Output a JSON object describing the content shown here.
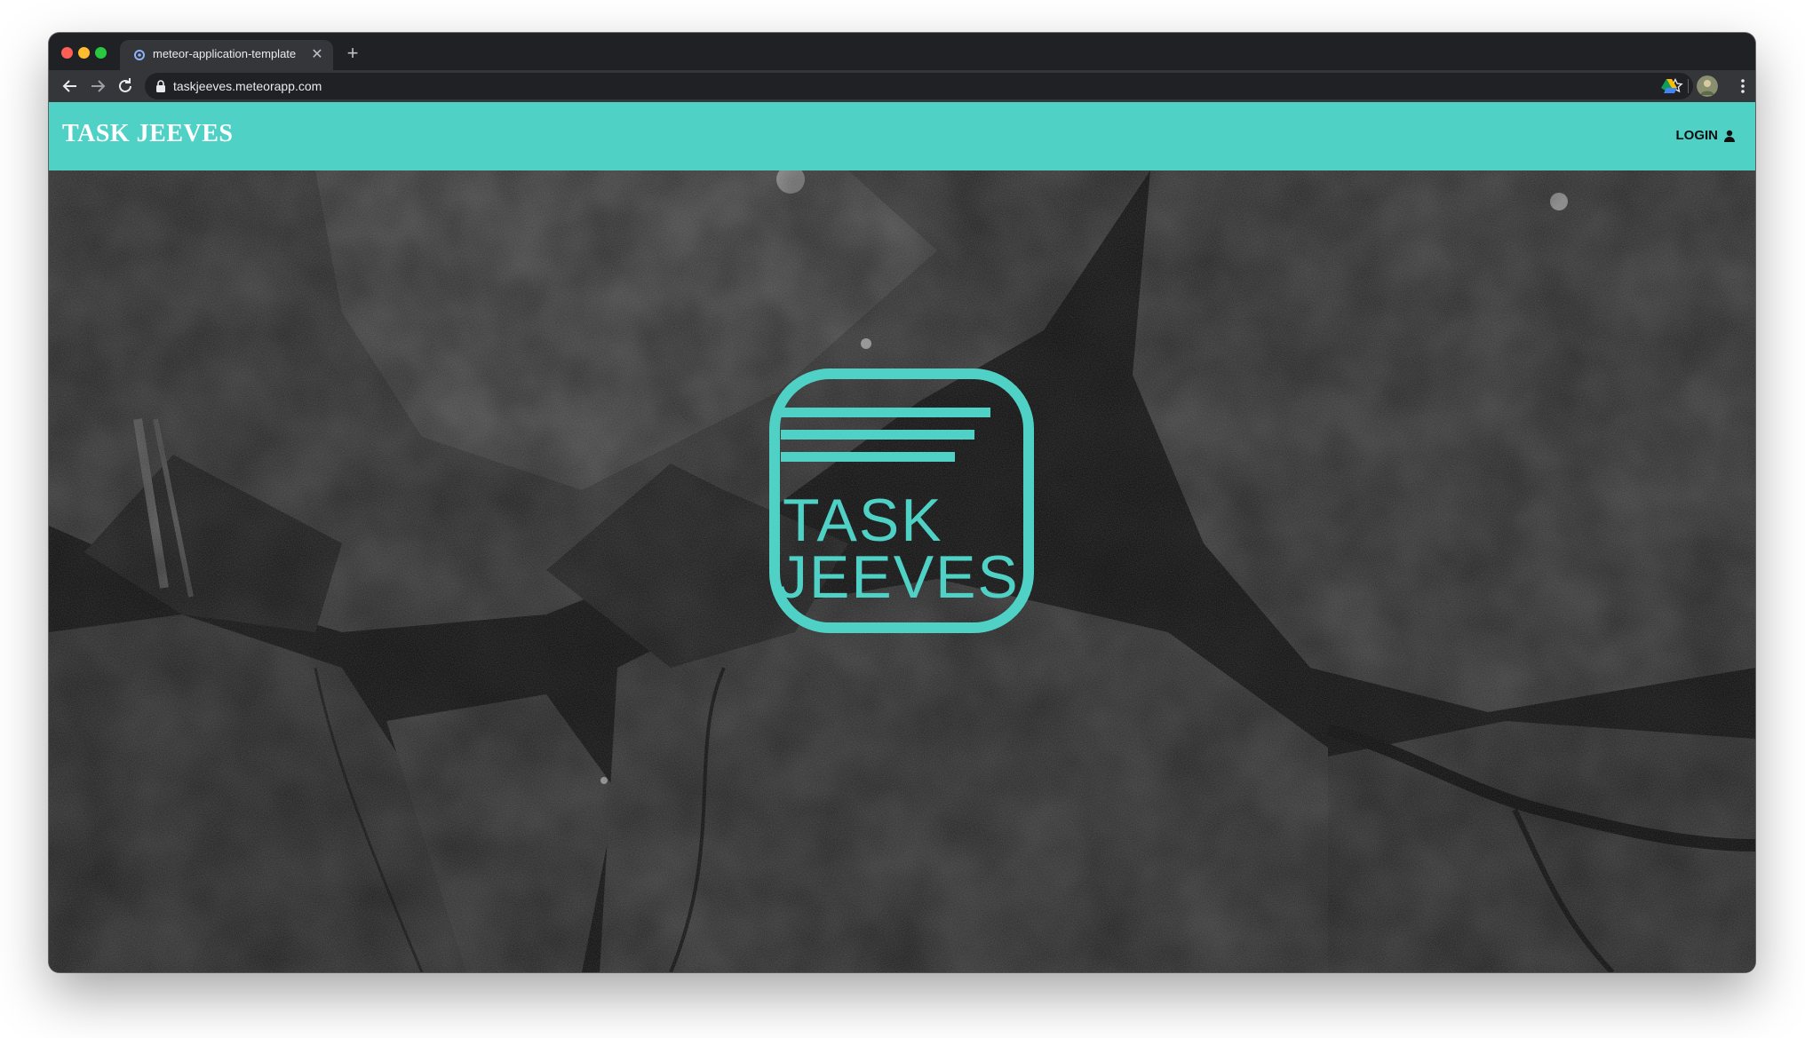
{
  "browser": {
    "tab_title": "meteor-application-template",
    "url": "taskjeeves.meteorapp.com"
  },
  "navbar": {
    "brand": "TASK JEEVES",
    "login_label": "LOGIN",
    "accent_color": "#4fd1c5"
  },
  "hero": {
    "logo_line1": "TASK",
    "logo_line2": "JEEVES"
  },
  "icons": [
    "favicon-icon",
    "close-icon",
    "plus-icon",
    "back-arrow-icon",
    "forward-arrow-icon",
    "reload-icon",
    "lock-icon",
    "star-icon",
    "drive-icon",
    "avatar",
    "kebab-menu-icon",
    "user-icon"
  ]
}
